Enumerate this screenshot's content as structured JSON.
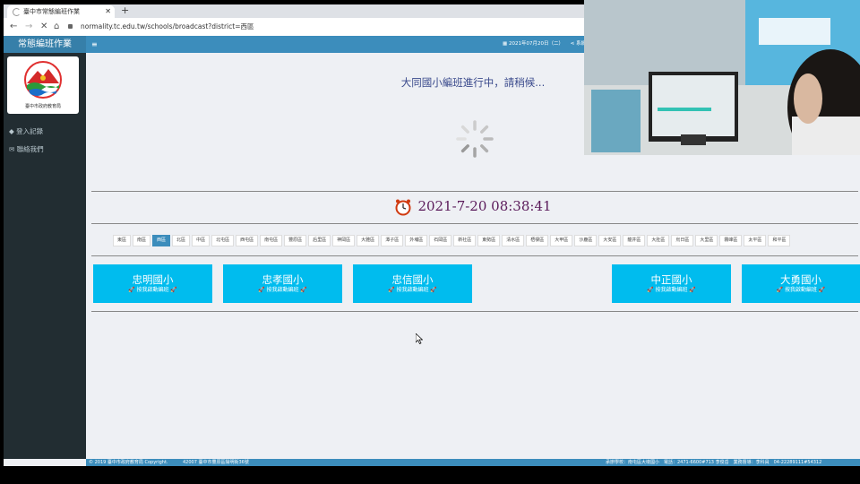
{
  "browser": {
    "tab_title": "臺中市常態編班作業",
    "new_tab": "+",
    "url": "normality.tc.edu.tw/schools/broadcast?district=西區",
    "nav": {
      "back": "←",
      "forward": "→",
      "stop": "✕",
      "home": "⌂"
    }
  },
  "header": {
    "brand": "常態編班作業",
    "menu_toggle": "≡",
    "date": "2021年07月20日（二）",
    "right_link": "系統說明"
  },
  "sidebar": {
    "logo_caption": "臺中市政府教育局",
    "items": [
      {
        "label": "登入記錄",
        "icon": "tag-icon"
      },
      {
        "label": "聯絡我們",
        "icon": "envelope-icon"
      }
    ]
  },
  "main": {
    "status_message": "大同國小編班進行中，請稍候...",
    "clock": "2021-7-20 08:38:41",
    "districts": [
      "東區",
      "南區",
      "西區",
      "北區",
      "中區",
      "北屯區",
      "西屯區",
      "南屯區",
      "豐原區",
      "后里區",
      "神岡區",
      "大雅區",
      "潭子區",
      "外埔區",
      "石岡區",
      "新社區",
      "東勢區",
      "清水區",
      "梧棲區",
      "大甲區",
      "沙鹿區",
      "大安區",
      "龍井區",
      "大肚區",
      "烏日區",
      "大里區",
      "霧峰區",
      "太平區",
      "和平區"
    ],
    "active_district": "西區",
    "schools": [
      {
        "name": "忠明國小",
        "status": "按我啟動編班"
      },
      {
        "name": "忠孝國小",
        "status": "按我啟動編班"
      },
      {
        "name": "忠信國小",
        "status": "按我啟動編班"
      },
      {
        "name": "中正國小",
        "status": "按我啟動編班"
      },
      {
        "name": "大勇國小",
        "status": "按我啟動編班"
      }
    ]
  },
  "footer": {
    "copyright": "© 2019 臺中市政府教育局 Copyright.",
    "address": "42007 臺中市豐原區陽明街36號",
    "contact": "承辦學校：南屯區大墩國小　電話：2471-6600#713 李俊岳　業務督導：李科員　04-22289111#54312"
  },
  "colors": {
    "header": "#3c8dbc",
    "sidebar": "#222d32",
    "school_button": "#00bcee",
    "clock": "#5a1a5a"
  }
}
